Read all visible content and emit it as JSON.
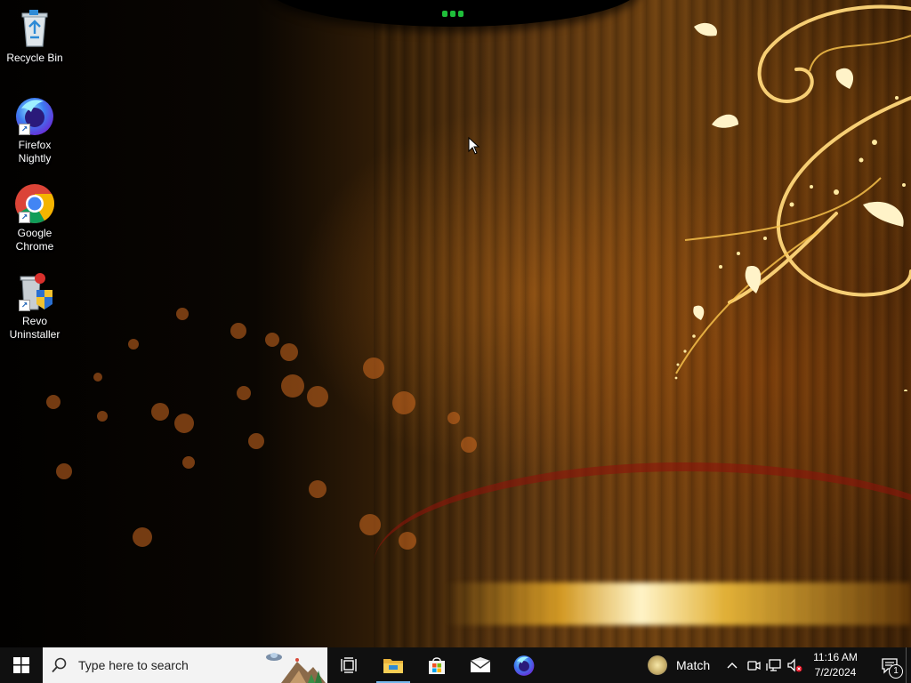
{
  "desktop": {
    "icons": [
      {
        "label": "Recycle Bin",
        "icon": "recycle-bin-icon"
      },
      {
        "label": "Firefox Nightly",
        "icon": "firefox-nightly-icon"
      },
      {
        "label": "Google Chrome",
        "icon": "chrome-icon"
      },
      {
        "label": "Revo Uninstaller",
        "icon": "revo-uninstaller-icon"
      }
    ],
    "icon_labels": {
      "recycle_bin": "Recycle Bin",
      "firefox_1": "Firefox",
      "firefox_2": "Nightly",
      "chrome_1": "Google",
      "chrome_2": "Chrome",
      "revo_1": "Revo",
      "revo_2": "Uninstaller"
    }
  },
  "taskbar": {
    "search_placeholder": "Type here to search",
    "pinned": [
      "task-view-icon",
      "file-explorer-icon",
      "microsoft-store-icon",
      "mail-icon",
      "firefox-nightly-icon"
    ],
    "weather_label": "Match",
    "clock_time": "11:16 AM",
    "clock_date": "7/2/2024",
    "notification_count": "1"
  },
  "colors": {
    "taskbar_bg": "#101010",
    "search_bg": "#f3f3f3",
    "active_indicator": "#76b9ed",
    "wallpaper_accent": "#e8a630"
  }
}
